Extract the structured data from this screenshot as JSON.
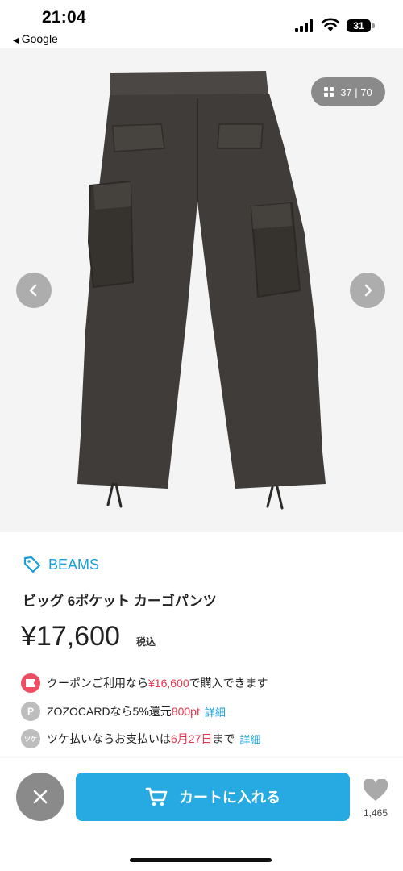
{
  "status_bar": {
    "time": "21:04",
    "back_app": "Google",
    "battery": "31"
  },
  "gallery": {
    "current": "37",
    "total": "70",
    "separator": "|"
  },
  "product": {
    "brand": "BEAMS",
    "title": "ビッグ 6ポケット カーゴパンツ",
    "price": "¥17,600",
    "tax_label": "税込"
  },
  "info": {
    "coupon": {
      "prefix": "クーポンご利用なら",
      "amount": "¥16,600",
      "suffix": "で購入できます"
    },
    "zozocard": {
      "badge": "P",
      "prefix": "ZOZOCARDなら5%還元 ",
      "points": "800pt",
      "link": "詳細"
    },
    "tsuke": {
      "badge": "ツケ",
      "prefix": "ツケ払いならお支払いは",
      "date": "6月27日",
      "suffix": "まで",
      "link": "詳細"
    }
  },
  "bottom_bar": {
    "cart_label": "カートに入れる",
    "favorite_count": "1,465"
  },
  "colors": {
    "accent": "#27a9e1",
    "brand_text": "#1aa0d8",
    "highlight_red": "#e5354d",
    "coupon_badge": "#ef4d63",
    "gray_button": "#8a8a8a"
  },
  "icons": [
    "back-triangle-icon",
    "signal-icon",
    "wifi-icon",
    "battery-icon",
    "grid-icon",
    "chevron-left-icon",
    "chevron-right-icon",
    "tag-icon",
    "coupon-icon",
    "points-icon",
    "tsuke-icon",
    "close-icon",
    "cart-icon",
    "heart-icon"
  ]
}
